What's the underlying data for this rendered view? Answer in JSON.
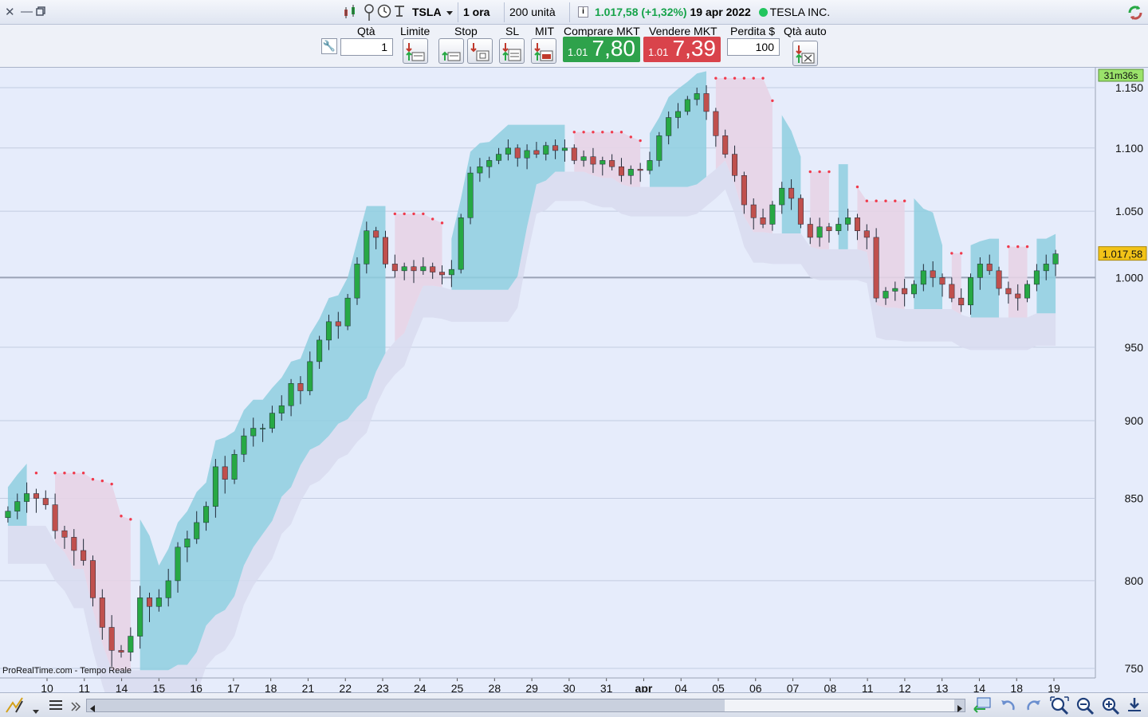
{
  "window": {
    "close": "✕",
    "minimize": "—",
    "restore": "🗗"
  },
  "toolbar": {
    "symbol": "TSLA",
    "timeframe": "1 ora",
    "units": "200 unità",
    "quote_price": "1.017,58",
    "quote_change": "(+1,32%)",
    "quote_date": "19 apr 2022",
    "company": "TESLA INC.",
    "icons": [
      "candlestick-chart-icon",
      "clock-icon",
      "cursor-icon",
      "refresh-icon"
    ]
  },
  "order": {
    "qty_label": "Qtà",
    "qty_value": "1",
    "limit_label": "Limite",
    "stop_label": "Stop",
    "sl_label": "SL",
    "mit_label": "MIT",
    "buy_label": "Comprare MKT",
    "buy_small": "1.01",
    "buy_big": "7,80",
    "sell_label": "Vendere MKT",
    "sell_small": "1.01",
    "sell_big": "7,39",
    "loss_label": "Perdita $",
    "loss_value": "100",
    "auto_qty_label": "Qtà auto"
  },
  "colors": {
    "bull": "#27a844",
    "bear": "#c0504d",
    "cloud_up": "#8ecfdf",
    "cloud_down": "#e7d4e6",
    "stop_dots": "#f03a4c",
    "bg": "#e6ecfb"
  },
  "chart_data": {
    "type": "candlestick",
    "countdown": "31m36s",
    "last_price_label": "1.017,58",
    "source": "ProRealTime.com - Tempo Reale",
    "y_ticks": [
      750,
      800,
      850,
      900,
      950,
      1000,
      1050,
      1100,
      1150
    ],
    "y_tick_labels": [
      "750",
      "800",
      "850",
      "900",
      "950",
      "1.000",
      "1.050",
      "1.100",
      "1.150"
    ],
    "ylim": [
      740,
      1160
    ],
    "x_labels": [
      "10",
      "11",
      "14",
      "15",
      "16",
      "17",
      "18",
      "21",
      "22",
      "23",
      "24",
      "25",
      "28",
      "29",
      "30",
      "31",
      "apr",
      "04",
      "05",
      "06",
      "07",
      "08",
      "11",
      "12",
      "13",
      "14",
      "18",
      "19"
    ],
    "x_bold": [
      "apr"
    ],
    "session_closes": [
      [
        842,
        848,
        853,
        850
      ],
      [
        846,
        830,
        826,
        818
      ],
      [
        812,
        790,
        773,
        760
      ],
      [
        759,
        768,
        790,
        785
      ],
      [
        790,
        800,
        820,
        825
      ],
      [
        835,
        845,
        870,
        862
      ],
      [
        878,
        890,
        895,
        895
      ],
      [
        905,
        910,
        925,
        920
      ],
      [
        940,
        955,
        968,
        965
      ],
      [
        985,
        1010,
        1035,
        1030
      ],
      [
        1010,
        1005,
        1008,
        1005
      ],
      [
        1008,
        1004,
        1002,
        1006
      ],
      [
        1045,
        1080,
        1085,
        1090
      ],
      [
        1095,
        1100,
        1092,
        1098
      ],
      [
        1095,
        1102,
        1098,
        1100
      ],
      [
        1090,
        1093,
        1087,
        1090
      ],
      [
        1085,
        1078,
        1083,
        1082
      ],
      [
        1090,
        1110,
        1125,
        1130
      ],
      [
        1140,
        1145,
        1130,
        1110
      ],
      [
        1095,
        1078,
        1055,
        1045
      ],
      [
        1040,
        1055,
        1068,
        1060
      ],
      [
        1040,
        1030,
        1038,
        1035
      ],
      [
        1040,
        1045,
        1035,
        1030
      ],
      [
        985,
        990,
        992,
        988
      ],
      [
        995,
        1005,
        1000,
        995
      ],
      [
        985,
        980,
        1000,
        1010
      ],
      [
        1005,
        992,
        988,
        985
      ],
      [
        995,
        1005,
        1010,
        1017.58
      ]
    ]
  },
  "bottom": {
    "icons": [
      "pencil-icon",
      "menu-icon",
      "chevrons-icon",
      "scroll-left-icon",
      "scroll-right-icon",
      "sync-chart-icon",
      "undo-icon",
      "redo-icon",
      "zoom-fit-icon",
      "zoom-out-icon",
      "zoom-in-icon",
      "download-icon"
    ]
  }
}
